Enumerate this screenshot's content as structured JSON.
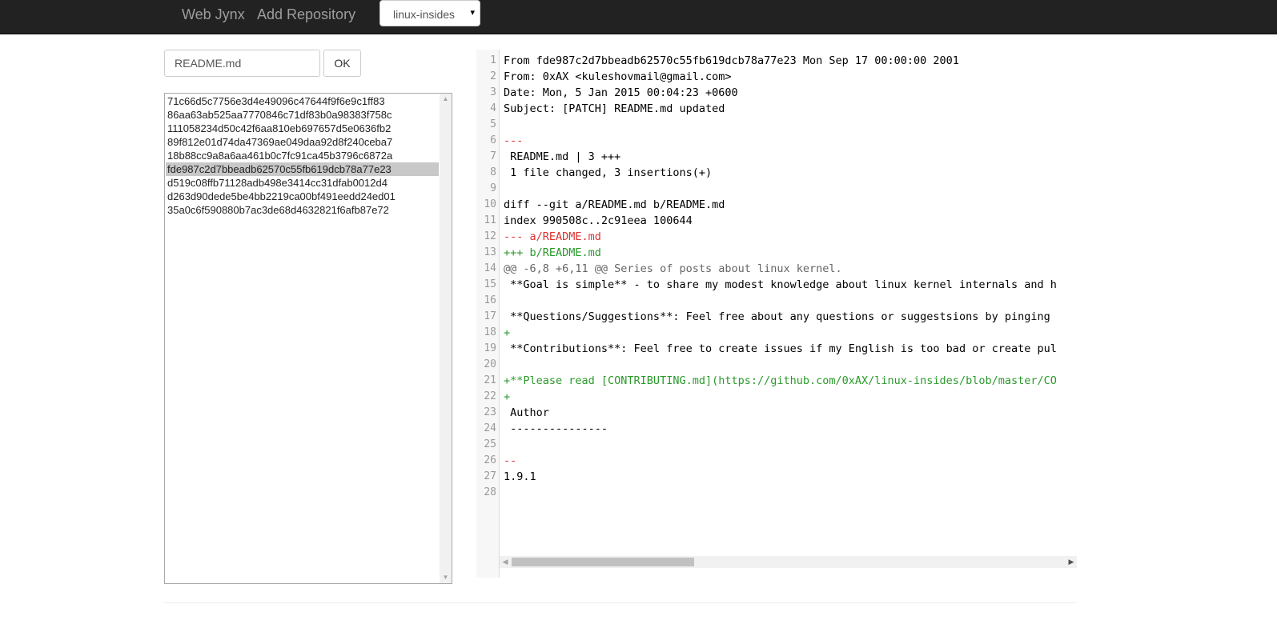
{
  "navbar": {
    "brand": "Web Jynx",
    "add_repository": "Add Repository",
    "repo_select": {
      "value": "linux-insides",
      "arrow": "▾"
    }
  },
  "search": {
    "value": "README.md",
    "ok_label": "OK"
  },
  "commits": {
    "items": [
      "71c66d5c7756e3d4e49096c47644f9f6e9c1ff83",
      "86aa63ab525aa7770846c71df83b0a98383f758c",
      "111058234d50c42f6aa810eb697657d5e0636fb2",
      "89f812e01d74da47369ae049daa92d8f240ceba7",
      "18b88cc9a8a6aa461b0c7fc91ca45b3796c6872a",
      "fde987c2d7bbeadb62570c55fb619dcb78a77e23",
      "d519c08ffb71128adb498e3414cc31dfab0012d4",
      "d263d90dede5be4bb2219ca00bf491eedd24ed01",
      "35a0c6f590880b7ac3de68d4632821f6afb87e72"
    ],
    "selected_index": 5
  },
  "code": {
    "lines": [
      {
        "num": "1",
        "text": "From fde987c2d7bbeadb62570c55fb619dcb78a77e23 Mon Sep 17 00:00:00 2001",
        "type": "plain"
      },
      {
        "num": "2",
        "text": "From: 0xAX <kuleshovmail@gmail.com>",
        "type": "plain"
      },
      {
        "num": "3",
        "text": "Date: Mon, 5 Jan 2015 00:04:23 +0600",
        "type": "plain"
      },
      {
        "num": "4",
        "text": "Subject: [PATCH] README.md updated",
        "type": "plain"
      },
      {
        "num": "5",
        "text": "",
        "type": "plain"
      },
      {
        "num": "6",
        "text": "---",
        "type": "del"
      },
      {
        "num": "7",
        "text": " README.md | 3 +++",
        "type": "plain"
      },
      {
        "num": "8",
        "text": " 1 file changed, 3 insertions(+)",
        "type": "plain"
      },
      {
        "num": "9",
        "text": "",
        "type": "plain"
      },
      {
        "num": "10",
        "text": "diff --git a/README.md b/README.md",
        "type": "plain"
      },
      {
        "num": "11",
        "text": "index 990508c..2c91eea 100644",
        "type": "plain"
      },
      {
        "num": "12",
        "text": "--- a/README.md",
        "type": "del"
      },
      {
        "num": "13",
        "text": "+++ b/README.md",
        "type": "add"
      },
      {
        "num": "14",
        "text": "@@ -6,8 +6,11 @@ Series of posts about linux kernel.",
        "type": "hunk"
      },
      {
        "num": "15",
        "text": " **Goal is simple** - to share my modest knowledge about linux kernel internals and h",
        "type": "plain"
      },
      {
        "num": "16",
        "text": "",
        "type": "plain"
      },
      {
        "num": "17",
        "text": " **Questions/Suggestions**: Feel free about any questions or suggestsions by pinging",
        "type": "plain"
      },
      {
        "num": "18",
        "text": "+",
        "type": "add"
      },
      {
        "num": "19",
        "text": " **Contributions**: Feel free to create issues if my English is too bad or create pul",
        "type": "plain"
      },
      {
        "num": "20",
        "text": "",
        "type": "plain"
      },
      {
        "num": "21",
        "text": "+**Please read [CONTRIBUTING.md](https://github.com/0xAX/linux-insides/blob/master/CO",
        "type": "add"
      },
      {
        "num": "22",
        "text": "+",
        "type": "add"
      },
      {
        "num": "23",
        "text": " Author",
        "type": "plain"
      },
      {
        "num": "24",
        "text": " ---------------",
        "type": "plain"
      },
      {
        "num": "25",
        "text": "",
        "type": "plain"
      },
      {
        "num": "26",
        "text": "--",
        "type": "del"
      },
      {
        "num": "27",
        "text": "1.9.1",
        "type": "plain"
      },
      {
        "num": "28",
        "text": "",
        "type": "plain"
      }
    ]
  },
  "colors": {
    "navbar_bg": "#222222",
    "navbar_text": "#9d9d9d",
    "diff_add": "#2a9a2a",
    "diff_del": "#dd3333",
    "diff_hunk": "#666666",
    "selected_row": "#c8c8c8"
  }
}
